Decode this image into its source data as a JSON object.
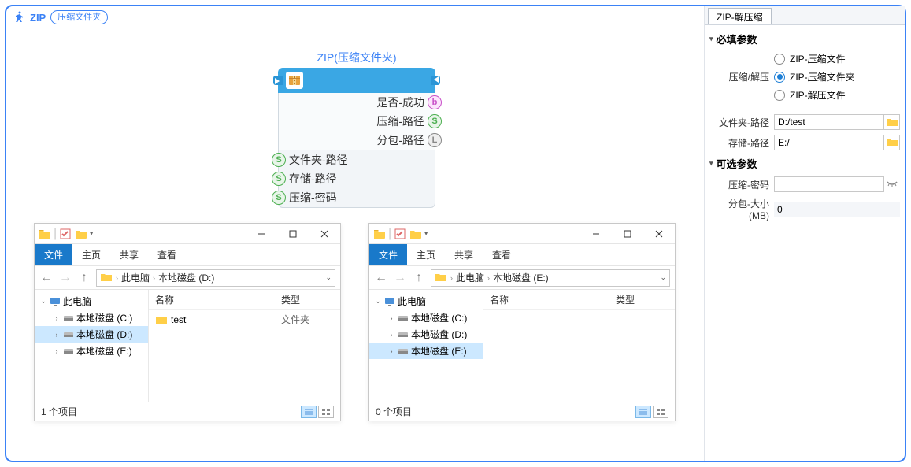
{
  "header": {
    "title": "ZIP",
    "badge": "压缩文件夹"
  },
  "node": {
    "title": "ZIP(压缩文件夹)",
    "outputs": [
      {
        "label": "是否-成功",
        "pin": "b"
      },
      {
        "label": "压缩-路径",
        "pin": "S"
      },
      {
        "label": "分包-路径",
        "pin": "L"
      }
    ],
    "inputs": [
      {
        "label": "文件夹-路径",
        "pin": "S"
      },
      {
        "label": "存储-路径",
        "pin": "S"
      },
      {
        "label": "压缩-密码",
        "pin": "S"
      }
    ]
  },
  "explorer_d": {
    "tabs": {
      "file": "文件",
      "home": "主页",
      "share": "共享",
      "view": "查看"
    },
    "breadcrumb": [
      "此电脑",
      "本地磁盘 (D:)"
    ],
    "tree": {
      "root": "此电脑",
      "drives": [
        "本地磁盘 (C:)",
        "本地磁盘 (D:)",
        "本地磁盘 (E:)"
      ],
      "selected": 1
    },
    "columns": {
      "name": "名称",
      "type": "类型"
    },
    "items": [
      {
        "name": "test",
        "type": "文件夹"
      }
    ],
    "status": "1 个项目"
  },
  "explorer_e": {
    "tabs": {
      "file": "文件",
      "home": "主页",
      "share": "共享",
      "view": "查看"
    },
    "breadcrumb": [
      "此电脑",
      "本地磁盘 (E:)"
    ],
    "tree": {
      "root": "此电脑",
      "drives": [
        "本地磁盘 (C:)",
        "本地磁盘 (D:)",
        "本地磁盘 (E:)"
      ],
      "selected": 2
    },
    "columns": {
      "name": "名称",
      "type": "类型"
    },
    "items": [],
    "status": "0 个项目"
  },
  "panel": {
    "tab": "ZIP-解压缩",
    "required_header": "必填参数",
    "optional_header": "可选参数",
    "mode_label": "压缩/解压",
    "mode_options": [
      "ZIP-压缩文件",
      "ZIP-压缩文件夹",
      "ZIP-解压文件"
    ],
    "mode_selected": 1,
    "folder_path_label": "文件夹-路径",
    "folder_path_value": "D:/test",
    "save_path_label": "存储-路径",
    "save_path_value": "E:/",
    "password_label": "压缩-密码",
    "password_value": "",
    "split_label": "分包-大小(MB)",
    "split_value": "0"
  }
}
